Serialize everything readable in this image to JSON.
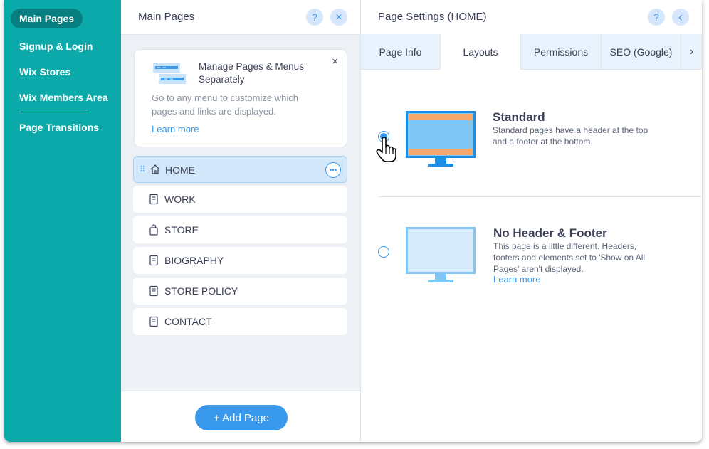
{
  "nav": {
    "items": [
      "Main Pages",
      "Signup & Login",
      "Wix Stores",
      "Wix Members Area",
      "Page Transitions"
    ]
  },
  "pages_panel": {
    "title": "Main Pages",
    "help_icon": "?",
    "close_icon": "✕",
    "card": {
      "title": "Manage Pages & Menus Separately",
      "text": "Go to any menu to customize which pages and links are displayed.",
      "link": "Learn more",
      "close": "×"
    },
    "pages": [
      "HOME",
      "WORK",
      "STORE",
      "BIOGRAPHY",
      "STORE POLICY",
      "CONTACT"
    ],
    "selected_page": "HOME",
    "add_button": "+ Add Page"
  },
  "settings_panel": {
    "title": "Page Settings (HOME)",
    "help_icon": "?",
    "back_icon": "‹",
    "tabs": [
      "Page Info",
      "Layouts",
      "Permissions",
      "SEO (Google)"
    ],
    "active_tab": "Layouts",
    "more_tabs_icon": "›",
    "layouts": [
      {
        "title": "Standard",
        "desc": "Standard pages have a header at the top and a footer at the bottom.",
        "selected": true
      },
      {
        "title": "No Header & Footer",
        "desc": "This page is a little different. Headers, footers and elements set to 'Show on All Pages' aren't displayed.",
        "link": "Learn more",
        "selected": false
      }
    ]
  },
  "colors": {
    "nav_bg": "#0ba9a9",
    "accent": "#3899ec",
    "monitor_header": "#f7a86b",
    "monitor_screen": "#80c7f6"
  }
}
